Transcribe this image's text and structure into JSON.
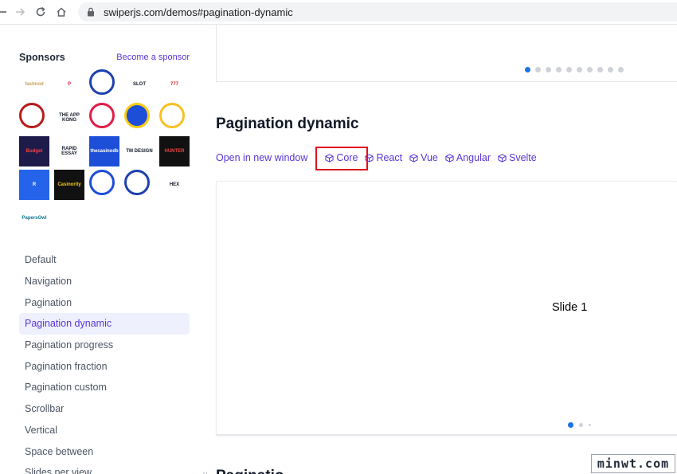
{
  "browser": {
    "url": "swiperjs.com/demos#pagination-dynamic"
  },
  "sidebar": {
    "sponsors_title": "Sponsors",
    "become_sponsor": "Become a sponsor",
    "sponsors": [
      {
        "label": "fastmod",
        "bg": "#ffffff",
        "fg": "#c8a15a"
      },
      {
        "label": "P",
        "bg": "#ffffff",
        "fg": "#e11d48"
      },
      {
        "label": "",
        "bg": "#ffffff",
        "fg": "#1e40af"
      },
      {
        "label": "SLOT",
        "bg": "#ffffff",
        "fg": "#111827"
      },
      {
        "label": "777",
        "bg": "#ffffff",
        "fg": "#dc2626"
      },
      {
        "label": "",
        "bg": "#ffffff",
        "fg": "#b91c1c"
      },
      {
        "label": "THE APP KONG",
        "bg": "#ffffff",
        "fg": "#111827"
      },
      {
        "label": "",
        "bg": "#ffffff",
        "fg": "#e11d48"
      },
      {
        "label": "",
        "bg": "#1d4ed8",
        "fg": "#facc15"
      },
      {
        "label": "",
        "bg": "#ffffff",
        "fg": "#fbbf24"
      },
      {
        "label": "Budget",
        "bg": "#1e1b4b",
        "fg": "#ef4444"
      },
      {
        "label": "RAPID ESSAY",
        "bg": "#ffffff",
        "fg": "#111827"
      },
      {
        "label": "thecasinodb",
        "bg": "#1d4ed8",
        "fg": "#ffffff"
      },
      {
        "label": "TM DESIGN",
        "bg": "#ffffff",
        "fg": "#111827"
      },
      {
        "label": "HUNTER",
        "bg": "#111111",
        "fg": "#ef4444"
      },
      {
        "label": "R",
        "bg": "#2563eb",
        "fg": "#ffffff"
      },
      {
        "label": "Casinority",
        "bg": "#111111",
        "fg": "#facc15"
      },
      {
        "label": "",
        "bg": "#ffffff",
        "fg": "#1d4ed8"
      },
      {
        "label": "",
        "bg": "#ffffff",
        "fg": "#1e40af"
      },
      {
        "label": "HEX",
        "bg": "#ffffff",
        "fg": "#111827"
      },
      {
        "label": "PapersOwl",
        "bg": "#ffffff",
        "fg": "#0e7490"
      }
    ],
    "nav": [
      {
        "label": "Default",
        "active": false
      },
      {
        "label": "Navigation",
        "active": false
      },
      {
        "label": "Pagination",
        "active": false
      },
      {
        "label": "Pagination dynamic",
        "active": true
      },
      {
        "label": "Pagination progress",
        "active": false
      },
      {
        "label": "Pagination fraction",
        "active": false
      },
      {
        "label": "Pagination custom",
        "active": false
      },
      {
        "label": "Scrollbar",
        "active": false
      },
      {
        "label": "Vertical",
        "active": false
      },
      {
        "label": "Space between",
        "active": false
      },
      {
        "label": "Slides per view",
        "active": false
      }
    ]
  },
  "main": {
    "title": "Pagination dynamic",
    "links": {
      "open_new": "Open in new window",
      "core": "Core",
      "react": "React",
      "vue": "Vue",
      "angular": "Angular",
      "svelte": "Svelte"
    },
    "slide_label": "Slide 1",
    "next_heading": "Paginatio",
    "hash": "#",
    "top_dots_count": 10,
    "top_dots_active": 0,
    "bottom_dots_active": 0
  },
  "watermark": "minwt.com",
  "colors": {
    "accent": "#5b34d6",
    "active_dot": "#1a73e8",
    "highlight_red": "#e3101a"
  }
}
